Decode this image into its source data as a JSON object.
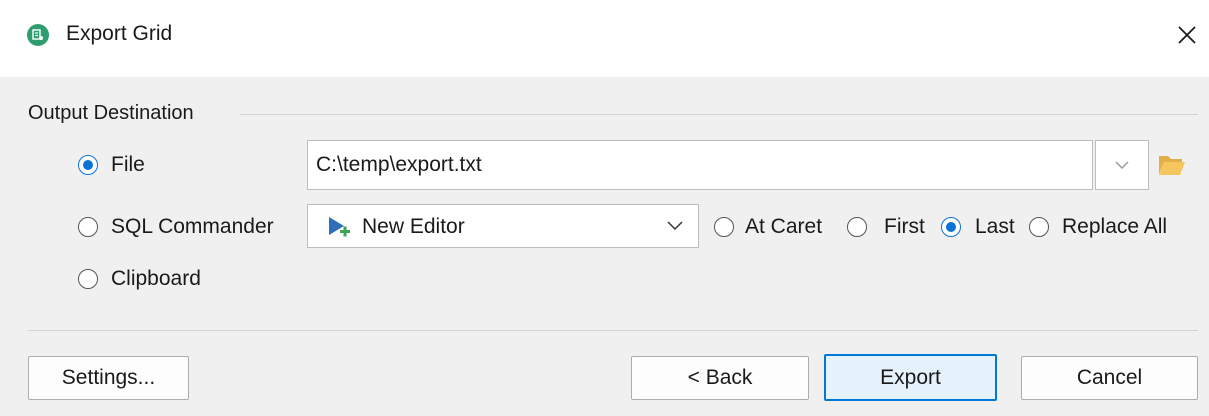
{
  "window": {
    "title": "Export Grid",
    "app_icon": "app-icon",
    "close_icon": "close-icon",
    "accent_color": "#0a74d6"
  },
  "output_destination": {
    "group_label": "Output Destination",
    "file": {
      "label": "File",
      "selected": true,
      "path_value": "C:\\temp\\export.txt",
      "dropdown_icon": "chevron-down-icon",
      "browse_icon": "folder-icon"
    },
    "sql_commander": {
      "label": "SQL Commander",
      "selected": false,
      "editor_value": "New Editor",
      "editor_icon": "new-editor-icon",
      "insert_options": [
        {
          "label": "At Caret",
          "selected": false
        },
        {
          "label": "First",
          "selected": false
        },
        {
          "label": "Last",
          "selected": true
        },
        {
          "label": "Replace All",
          "selected": false
        }
      ]
    },
    "clipboard": {
      "label": "Clipboard",
      "selected": false
    }
  },
  "buttons": {
    "settings": "Settings...",
    "back": "< Back",
    "export": "Export",
    "cancel": "Cancel"
  }
}
